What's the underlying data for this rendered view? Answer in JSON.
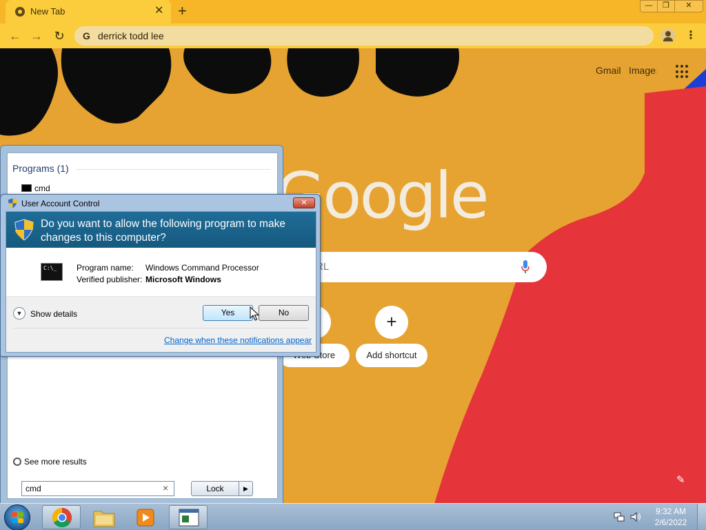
{
  "browser": {
    "tab": {
      "title": "New Tab",
      "close_glyph": "✕"
    },
    "new_tab_glyph": "+",
    "window_controls": {
      "minimize": "—",
      "maximize": "❐",
      "close": "✕"
    },
    "nav": {
      "back": "←",
      "forward": "→",
      "reload": "↻"
    },
    "omnibox": {
      "value": "derrick todd lee",
      "g_glyph": "G"
    },
    "menu_glyph": "⋮"
  },
  "ntp": {
    "links": {
      "gmail": "Gmail",
      "images": "Images"
    },
    "logo": "Google",
    "search_placeholder": "Search Google or type a URL",
    "search_visible": "RL",
    "shortcuts": [
      {
        "label": "Web Store",
        "visible": "Web Store"
      },
      {
        "label": "Add shortcut",
        "glyph": "+"
      }
    ],
    "customize_glyph": "✎"
  },
  "start_menu": {
    "section": "Programs (1)",
    "result": "cmd",
    "see_more": "See more results",
    "search_value": "cmd",
    "clear_glyph": "×",
    "lock_label": "Lock",
    "lock_arrow": "▶"
  },
  "uac": {
    "title": "User Account Control",
    "close_glyph": "✕",
    "question": "Do you want to allow the following program to make changes to this computer?",
    "program_name_label": "Program name:",
    "program_name": "Windows Command Processor",
    "publisher_label": "Verified publisher:",
    "publisher": "Microsoft Windows",
    "show_details": "Show details",
    "yes": "Yes",
    "no": "No",
    "change_link": "Change when these notifications appear",
    "prog_icon_text": "C:\\_"
  },
  "taskbar": {
    "time": "9:32 AM",
    "date": "2/6/2022",
    "flag_colors": [
      "#f25022",
      "#7fba00",
      "#00a4ef",
      "#ffb900"
    ]
  },
  "icons": [
    "chrome-logo-icon",
    "profile-icon",
    "apps-grid-icon",
    "mic-icon",
    "pencil-icon",
    "shield-icon",
    "cmd-icon",
    "cursor-icon",
    "windows-flag-icon",
    "folder-icon",
    "media-player-icon",
    "network-icon",
    "volume-icon"
  ],
  "colors": {
    "ntp_bg": "#e6a331",
    "accent_red": "#e5343a",
    "accent_blue": "#1c3ed6",
    "uac_banner": "#1f6d98",
    "link": "#0066cc"
  }
}
